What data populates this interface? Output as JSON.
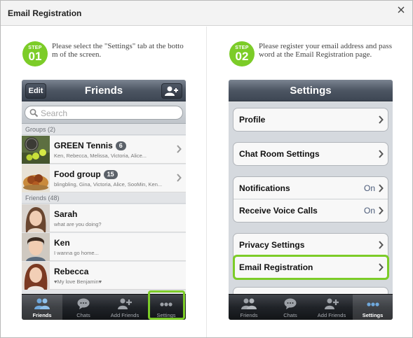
{
  "dialog": {
    "title": "Email Registration"
  },
  "steps": [
    {
      "label": "STEP",
      "number": "01",
      "text": "Please select the \"Settings\" tab at the bottom of the screen."
    },
    {
      "label": "STEP",
      "number": "02",
      "text": "Please register your email address and password at the Email Registration page."
    }
  ],
  "friends_screen": {
    "title": "Friends",
    "edit_label": "Edit",
    "search_placeholder": "Search",
    "groups_header": "Groups (2)",
    "groups": [
      {
        "name": "GREEN Tennis",
        "count": "6",
        "members": "Ken, Rebecca, Melissa, Victoria, Alice..."
      },
      {
        "name": "Food group",
        "count": "15",
        "members": "blingbling, Gina, Victoria, Alice, SooMin, Ken..."
      }
    ],
    "friends_header": "Friends (48)",
    "friends": [
      {
        "name": "Sarah",
        "status": "what are you doing?"
      },
      {
        "name": "Ken",
        "status": "I wanna go home..."
      },
      {
        "name": "Rebecca",
        "status": "♥My love Benjamin♥"
      }
    ]
  },
  "settings_screen": {
    "title": "Settings",
    "groups": [
      [
        {
          "label": "Profile",
          "value": ""
        }
      ],
      [
        {
          "label": "Chat Room Settings",
          "value": ""
        }
      ],
      [
        {
          "label": "Notifications",
          "value": "On"
        },
        {
          "label": "Receive Voice Calls",
          "value": "On"
        }
      ],
      [
        {
          "label": "Privacy Settings",
          "value": ""
        },
        {
          "label": "Email Registration",
          "value": ""
        }
      ]
    ]
  },
  "tabbar": [
    "Friends",
    "Chats",
    "Add Friends",
    "Settings"
  ],
  "colors": {
    "accent_green": "#7ccc28",
    "nav_dark": "#4d5663"
  }
}
